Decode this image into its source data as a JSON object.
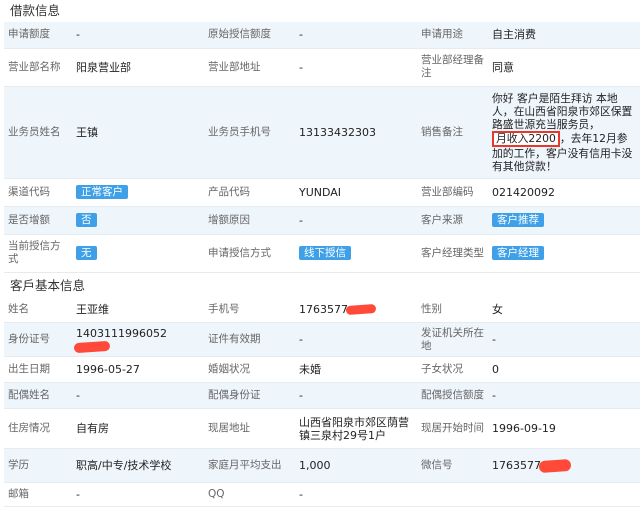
{
  "sections": {
    "loan_title": "借款信息",
    "customer_title": "客戶基本信息"
  },
  "loan": {
    "apply_amount_label": "申请额度",
    "apply_amount": "-",
    "orig_credit_label": "原始授信额度",
    "orig_credit": "-",
    "purpose_label": "申请用途",
    "purpose": "自主消费",
    "branch_name_label": "营业部名称",
    "branch_name": "阳泉营业部",
    "branch_addr_label": "营业部地址",
    "branch_addr": "-",
    "mgr_remark_label": "营业部经理备注",
    "mgr_remark": "同意",
    "agent_name_label": "业务员姓名",
    "agent_name": "王镇",
    "agent_phone_label": "业务员手机号",
    "agent_phone": "13133432303",
    "sales_remark_label": "销售备注",
    "sales_remark_part1": "你好 客户是陌生拜访 本地人，在山西省阳泉市郊区保置路盛世源充当服务员，",
    "sales_remark_highlight": "月收入2200",
    "sales_remark_part2": "，去年12月参加的工作，客户没有信用卡没有其他贷款！",
    "channel_label": "渠道代码",
    "channel_tag": "正常客户",
    "product_label": "产品代码",
    "product": "YUNDAI",
    "branch_code_label": "营业部编码",
    "branch_code": "021420092",
    "is_increase_label": "是否增额",
    "is_increase_tag": "否",
    "increase_reason_label": "增额原因",
    "increase_reason": "-",
    "cust_source_label": "客户来源",
    "cust_source_tag": "客户推荐",
    "curr_credit_label": "当前授信方式",
    "curr_credit_tag": "无",
    "apply_credit_label": "申请授信方式",
    "apply_credit_tag": "线下授信",
    "mgr_type_label": "客户经理类型",
    "mgr_type_tag": "客户经理"
  },
  "customer": {
    "name_label": "姓名",
    "name": "王亚维",
    "mobile_label": "手机号",
    "mobile": "1763577",
    "gender_label": "性别",
    "gender": "女",
    "id_label": "身份证号",
    "id": "1403111996052",
    "cert_valid_label": "证件有效期",
    "cert_valid": "-",
    "issuer_label": "发证机关所在地",
    "issuer": "-",
    "birth_label": "出生日期",
    "birth": "1996-05-27",
    "marital_label": "婚姻状况",
    "marital": "未婚",
    "children_label": "子女状况",
    "children": "0",
    "spouse_name_label": "配偶姓名",
    "spouse_name": "-",
    "spouse_id_label": "配偶身份证",
    "spouse_id": "-",
    "spouse_credit_label": "配偶授信额度",
    "spouse_credit": "-",
    "housing_label": "住房情况",
    "housing": "自有房",
    "address_label": "现居地址",
    "address": "山西省阳泉市郊区荫营镇三泉村29号1户",
    "since_label": "现居开始时间",
    "since": "1996-09-19",
    "edu_label": "学历",
    "edu": "职高/中专/技术学校",
    "expense_label": "家庭月平均支出",
    "expense": "1,000",
    "wechat_label": "微信号",
    "wechat": "1763577",
    "email_label": "邮箱",
    "email": "-",
    "qq_label": "QQ",
    "qq": "-"
  },
  "colors": {
    "tag_bg": "#3fa0e8",
    "row_alt": "#eef5fb",
    "redact": "#ff4a3a",
    "highlight_border": "#e7392b"
  }
}
